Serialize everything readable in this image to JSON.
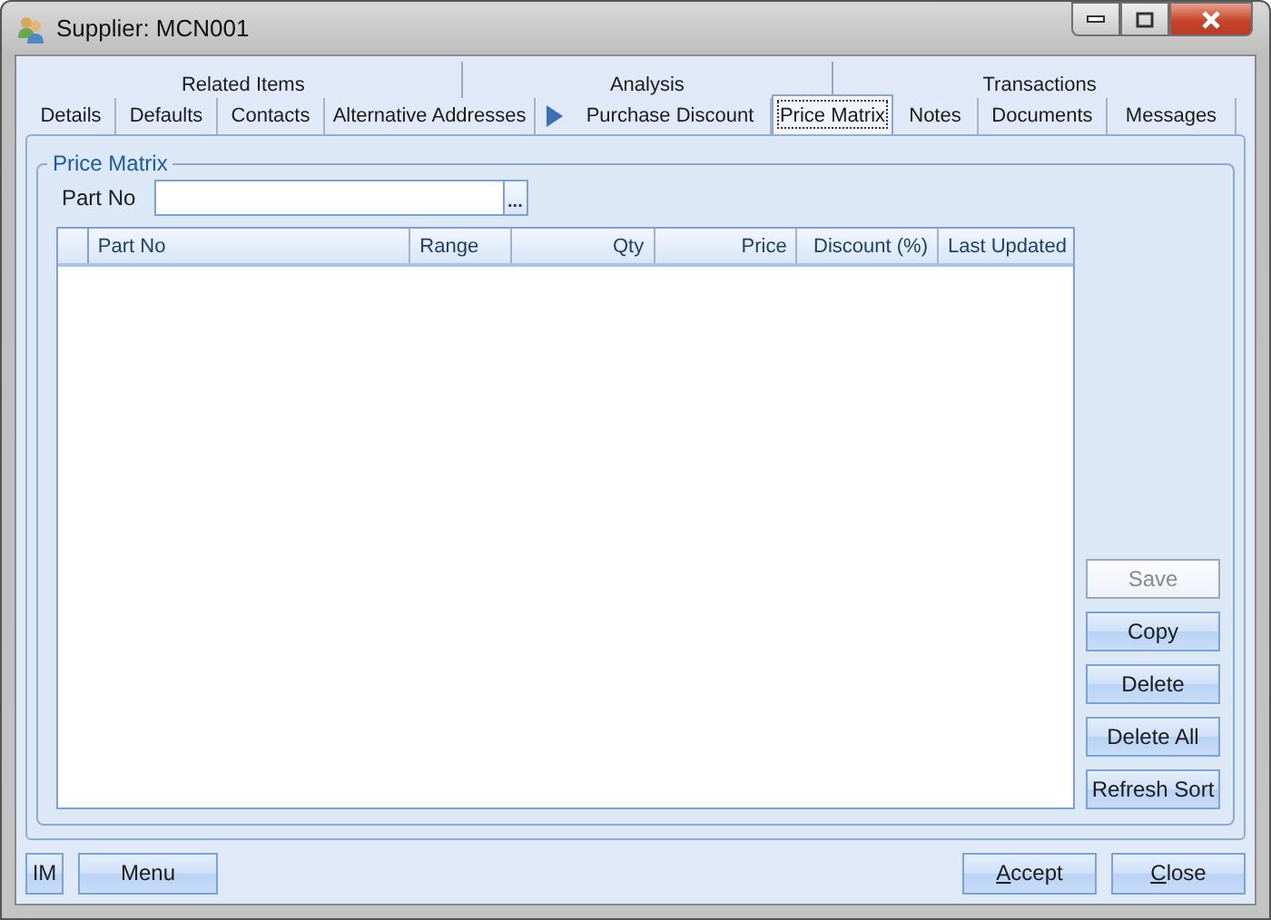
{
  "window": {
    "title": "Supplier: MCN001"
  },
  "tab_rows": [
    [
      {
        "label": "Related Items",
        "selected": false
      },
      {
        "label": "Analysis",
        "selected": false
      },
      {
        "label": "Transactions",
        "selected": false
      }
    ],
    [
      {
        "label": "Details",
        "selected": false
      },
      {
        "label": "Defaults",
        "selected": false
      },
      {
        "label": "Contacts",
        "selected": false
      },
      {
        "label": "Alternative Addresses",
        "selected": false
      },
      {
        "label": "Purchase Discount",
        "selected": false
      },
      {
        "label": "Price Matrix",
        "selected": true
      },
      {
        "label": "Notes",
        "selected": false
      },
      {
        "label": "Documents",
        "selected": false
      },
      {
        "label": "Messages",
        "selected": false
      }
    ]
  ],
  "group": {
    "title": "Price Matrix",
    "part_no": {
      "label": "Part No",
      "browse": "..."
    }
  },
  "table": {
    "columns": [
      {
        "label": "Part No"
      },
      {
        "label": "Range"
      },
      {
        "label": "Qty"
      },
      {
        "label": "Price"
      },
      {
        "label": "Discount (%)"
      },
      {
        "label": "Last Updated"
      }
    ]
  },
  "side_buttons": [
    {
      "label": "Save",
      "disabled": true
    },
    {
      "label": "Copy",
      "disabled": false
    },
    {
      "label": "Delete",
      "disabled": false
    },
    {
      "label": "Delete All",
      "disabled": false
    },
    {
      "label": "Refresh Sort",
      "disabled": false
    }
  ],
  "footer": {
    "left": [
      {
        "label": "IM"
      },
      {
        "label": "Menu"
      }
    ],
    "right": [
      {
        "label": "Accept",
        "mnemonic": true
      },
      {
        "label": "Close",
        "mnemonic": true
      }
    ]
  }
}
